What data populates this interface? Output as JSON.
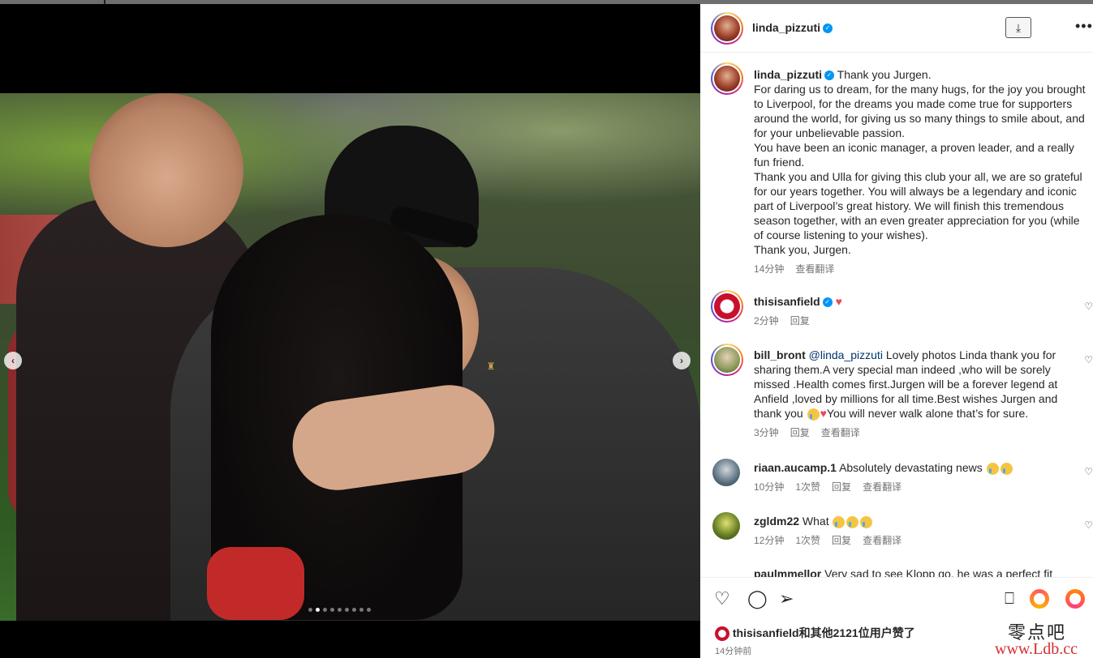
{
  "post": {
    "dots_total": 9,
    "dots_active": 1
  },
  "header": {
    "username": "linda_pizzuti"
  },
  "caption": {
    "username": "linda_pizzuti",
    "lines": [
      "Thank you Jurgen.",
      "For daring us to dream, for the many hugs, for the joy you brought to Liverpool, for the dreams you made come true for supporters around the world, for giving us so many things to smile about, and for your unbelievable passion.",
      "You have been an iconic manager, a proven leader, and a really fun friend.",
      "Thank you and Ulla for giving this club your all, we are so grateful for our years together. You will always be a legendary and iconic part of Liverpool’s great history. We will finish this tremendous season together, with an even greater appreciation for you (while of course listening to your wishes).",
      "Thank you, Jurgen."
    ],
    "time": "14分钟",
    "translate": "查看翻译"
  },
  "comments": [
    {
      "username": "thisisanfield",
      "text": "",
      "time": "2分钟",
      "reply": "回复"
    },
    {
      "username": "bill_bront",
      "mention": "@linda_pizzuti",
      "text": " Lovely photos Linda thank you for sharing them.A very special man indeed ,who will be sorely missed .Health comes first.Jurgen will be a forever legend at Anfield ,loved by millions for all time.Best wishes Jurgen and thank you ",
      "text2": "You will never walk alone that’s for sure.",
      "time": "3分钟",
      "reply": "回复",
      "translate": "查看翻译"
    },
    {
      "username": "riaan.aucamp.1",
      "text": "Absolutely devastating news",
      "time": "10分钟",
      "likes": "1次赞",
      "reply": "回复",
      "translate": "查看翻译"
    },
    {
      "username": "zgldm22",
      "text": "What",
      "time": "12分钟",
      "likes": "1次赞",
      "reply": "回复",
      "translate": "查看翻译"
    },
    {
      "username": "paulmmellor",
      "text": "Very sad to see Klopp go, he was a perfect fit"
    }
  ],
  "likes_line": {
    "username": "thisisanfield",
    "text": "和其他2121位用户赞了"
  },
  "bottom_time": "14分钟前",
  "watermark": {
    "top": "零点吧",
    "bottom": "www.Ldb.cc"
  }
}
